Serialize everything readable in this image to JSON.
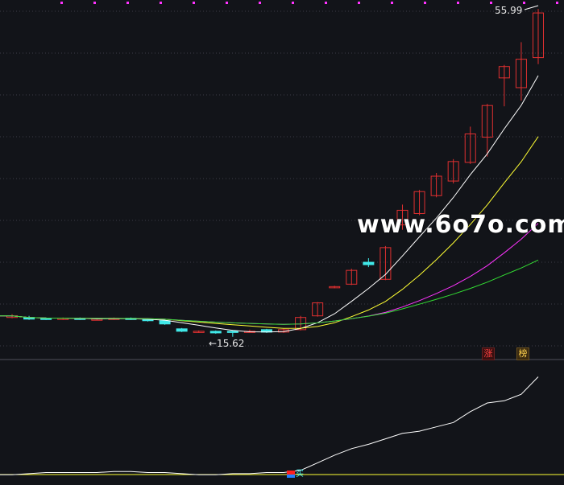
{
  "chart": {
    "high_label": "55.99",
    "low_label": "←15.62",
    "watermark": "www.6o7o.com",
    "badges": {
      "zhang": "涨",
      "bang": "榜"
    },
    "signal_label": "买"
  },
  "colors": {
    "background": "#121419",
    "grid": "#3c3c46",
    "up": "#e03030",
    "down": "#40e8e8",
    "ma5": "#ffffff",
    "ma10": "#ffff33",
    "ma20": "#ff33ff",
    "ma60": "#33dd33",
    "indicator": "#ffffff",
    "indicator_base": "#ffff33"
  },
  "chart_data": {
    "type": "candlestick",
    "price_max": 55.99,
    "price_min": 15.62,
    "candles": [
      {
        "o": 18.0,
        "c": 18.2,
        "h": 18.4,
        "l": 17.9
      },
      {
        "o": 18.0,
        "c": 17.8,
        "h": 18.2,
        "l": 17.7
      },
      {
        "o": 17.9,
        "c": 17.8,
        "h": 18.0,
        "l": 17.7
      },
      {
        "o": 17.8,
        "c": 17.9,
        "h": 18.0,
        "l": 17.7
      },
      {
        "o": 17.9,
        "c": 17.8,
        "h": 18.0,
        "l": 17.7
      },
      {
        "o": 17.8,
        "c": 17.8,
        "h": 17.9,
        "l": 17.7
      },
      {
        "o": 17.8,
        "c": 17.9,
        "h": 18.0,
        "l": 17.7
      },
      {
        "o": 17.9,
        "c": 17.8,
        "h": 18.0,
        "l": 17.7
      },
      {
        "o": 17.8,
        "c": 17.6,
        "h": 17.9,
        "l": 17.5
      },
      {
        "o": 17.6,
        "c": 17.2,
        "h": 17.7,
        "l": 17.1
      },
      {
        "o": 16.6,
        "c": 16.3,
        "h": 16.7,
        "l": 16.2
      },
      {
        "o": 16.2,
        "c": 16.3,
        "h": 16.4,
        "l": 16.1
      },
      {
        "o": 16.3,
        "c": 16.1,
        "h": 16.4,
        "l": 16.0
      },
      {
        "o": 16.3,
        "c": 16.2,
        "h": 16.4,
        "l": 15.62
      },
      {
        "o": 16.3,
        "c": 16.3,
        "h": 16.5,
        "l": 16.2
      },
      {
        "o": 16.5,
        "c": 16.2,
        "h": 16.6,
        "l": 16.1
      },
      {
        "o": 16.2,
        "c": 16.5,
        "h": 16.6,
        "l": 16.1
      },
      {
        "o": 16.5,
        "c": 18.0,
        "h": 18.2,
        "l": 16.4
      },
      {
        "o": 18.2,
        "c": 19.8,
        "h": 19.9,
        "l": 18.1
      },
      {
        "o": 21.7,
        "c": 21.8,
        "h": 21.9,
        "l": 21.6
      },
      {
        "o": 22.1,
        "c": 23.8,
        "h": 24.0,
        "l": 22.0
      },
      {
        "o": 24.8,
        "c": 24.5,
        "h": 25.3,
        "l": 24.2
      },
      {
        "o": 22.7,
        "c": 26.6,
        "h": 26.8,
        "l": 22.6
      },
      {
        "o": 29.4,
        "c": 31.2,
        "h": 31.9,
        "l": 28.8
      },
      {
        "o": 30.8,
        "c": 33.5,
        "h": 33.7,
        "l": 30.6
      },
      {
        "o": 33.0,
        "c": 35.4,
        "h": 35.8,
        "l": 32.8
      },
      {
        "o": 34.8,
        "c": 37.2,
        "h": 37.5,
        "l": 34.5
      },
      {
        "o": 37.1,
        "c": 40.6,
        "h": 41.5,
        "l": 36.9
      },
      {
        "o": 40.2,
        "c": 44.1,
        "h": 44.3,
        "l": 37.8
      },
      {
        "o": 47.5,
        "c": 48.9,
        "h": 49.1,
        "l": 44.0
      },
      {
        "o": 46.3,
        "c": 49.8,
        "h": 51.9,
        "l": 44.7
      },
      {
        "o": 50.0,
        "c": 55.5,
        "h": 55.99,
        "l": 49.2
      }
    ],
    "indicator": [
      20,
      21,
      22,
      22,
      22,
      22,
      23,
      23,
      22,
      22,
      21,
      20,
      20,
      21,
      21,
      22,
      22,
      24,
      31,
      38,
      44,
      48,
      53,
      58,
      60,
      64,
      68,
      78,
      86,
      88,
      94,
      110
    ]
  }
}
